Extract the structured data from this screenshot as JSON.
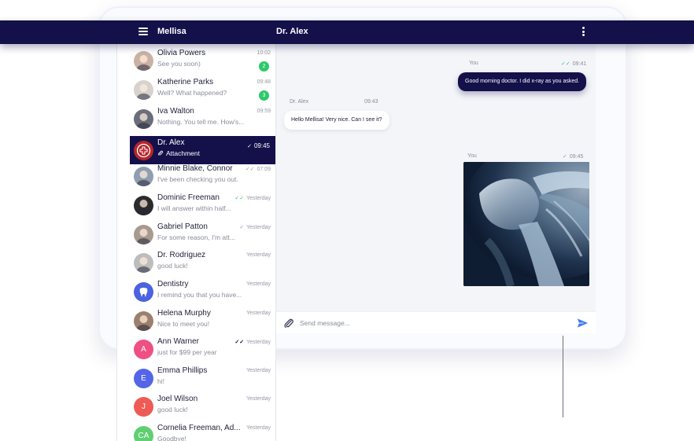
{
  "header": {
    "user_name": "Mellisa",
    "chat_title": "Dr. Alex"
  },
  "contacts": [
    {
      "name": "Olivia Powers",
      "preview": "See you soon)",
      "time": "10:02",
      "badge": "2",
      "tick": "",
      "avatar_type": "photo",
      "avatar_color": "#c9b2a4"
    },
    {
      "name": "Katherine Parks",
      "preview": "Well? What happened?",
      "time": "09:48",
      "badge": "3",
      "tick": "",
      "avatar_type": "photo",
      "avatar_color": "#d7d2cd"
    },
    {
      "name": "Iva Walton",
      "preview": "Nothing. You tell me. How's...",
      "time": "09:59",
      "badge": "",
      "tick": "",
      "avatar_type": "photo",
      "avatar_color": "#6a6e7a"
    },
    {
      "name": "Dr. Alex",
      "preview": "Attachment",
      "time": "09:45",
      "badge": "",
      "tick": "✓",
      "avatar_type": "icon",
      "avatar_color": "#b3262b"
    },
    {
      "name": "Minnie Blake, Connor",
      "preview": "I've been checking you out.",
      "time": "07:09",
      "badge": "",
      "tick": "✓✓",
      "avatar_type": "photo",
      "avatar_color": "#8f9eb0"
    },
    {
      "name": "Dominic Freeman",
      "preview": "I will answer within half...",
      "time": "Yesterday",
      "badge": "",
      "tick": "✓✓",
      "avatar_type": "photo",
      "avatar_color": "#2b2b2b"
    },
    {
      "name": "Gabriel Patton",
      "preview": "For some reason, I'm att...",
      "time": "Yesterday",
      "badge": "",
      "tick": "✓",
      "avatar_type": "photo",
      "avatar_color": "#a79a8e"
    },
    {
      "name": "Dr. Rodriguez",
      "preview": "good luck!",
      "time": "Yesterday",
      "badge": "",
      "tick": "",
      "avatar_type": "photo",
      "avatar_color": "#bdbdbd"
    },
    {
      "name": "Dentistry",
      "preview": "I remind you that you have...",
      "time": "Yesterday",
      "badge": "",
      "tick": "",
      "avatar_type": "icon",
      "avatar_color": "#4b63e0"
    },
    {
      "name": "Helena Murphy",
      "preview": "Nice to meet you!",
      "time": "Yesterday",
      "badge": "",
      "tick": "",
      "avatar_type": "photo",
      "avatar_color": "#9c7f6c"
    },
    {
      "name": "Ann Warner",
      "preview": "just for $99 per year",
      "time": "Yesterday",
      "badge": "",
      "tick": "✓✓",
      "avatar_type": "initial",
      "initial": "A",
      "avatar_color": "#ef4f82"
    },
    {
      "name": "Emma Phillips",
      "preview": "hi!",
      "time": "Yesterday",
      "badge": "",
      "tick": "",
      "avatar_type": "initial",
      "initial": "E",
      "avatar_color": "#5465e8"
    },
    {
      "name": "Joel Wilson",
      "preview": "good luck!",
      "time": "Yesterday",
      "badge": "",
      "tick": "",
      "avatar_type": "initial",
      "initial": "J",
      "avatar_color": "#ee5a55"
    },
    {
      "name": "Cornelia Freeman, Ad...",
      "preview": "Goodbye!",
      "time": "Yesterday",
      "badge": "",
      "tick": "",
      "avatar_type": "initial",
      "initial": "CA",
      "avatar_color": "#5fcf72"
    }
  ],
  "messages": [
    {
      "sender": "You",
      "time": "09:41",
      "tick": "✓✓",
      "text": "Good morning doctor. I did x-ray as you asked.",
      "direction": "out"
    },
    {
      "sender": "Dr. Alex",
      "time": "09:43",
      "tick": "",
      "text": "Hello Mellisa! Very nice. Can I see it?",
      "direction": "in"
    },
    {
      "sender": "You",
      "time": "09:45",
      "tick": "✓",
      "text": "",
      "direction": "out",
      "attachment": "x-ray image"
    }
  ],
  "composer": {
    "placeholder": "Send message..."
  },
  "colors": {
    "navy": "#14104a",
    "green": "#2ec86a",
    "send_blue": "#3d7be8"
  }
}
